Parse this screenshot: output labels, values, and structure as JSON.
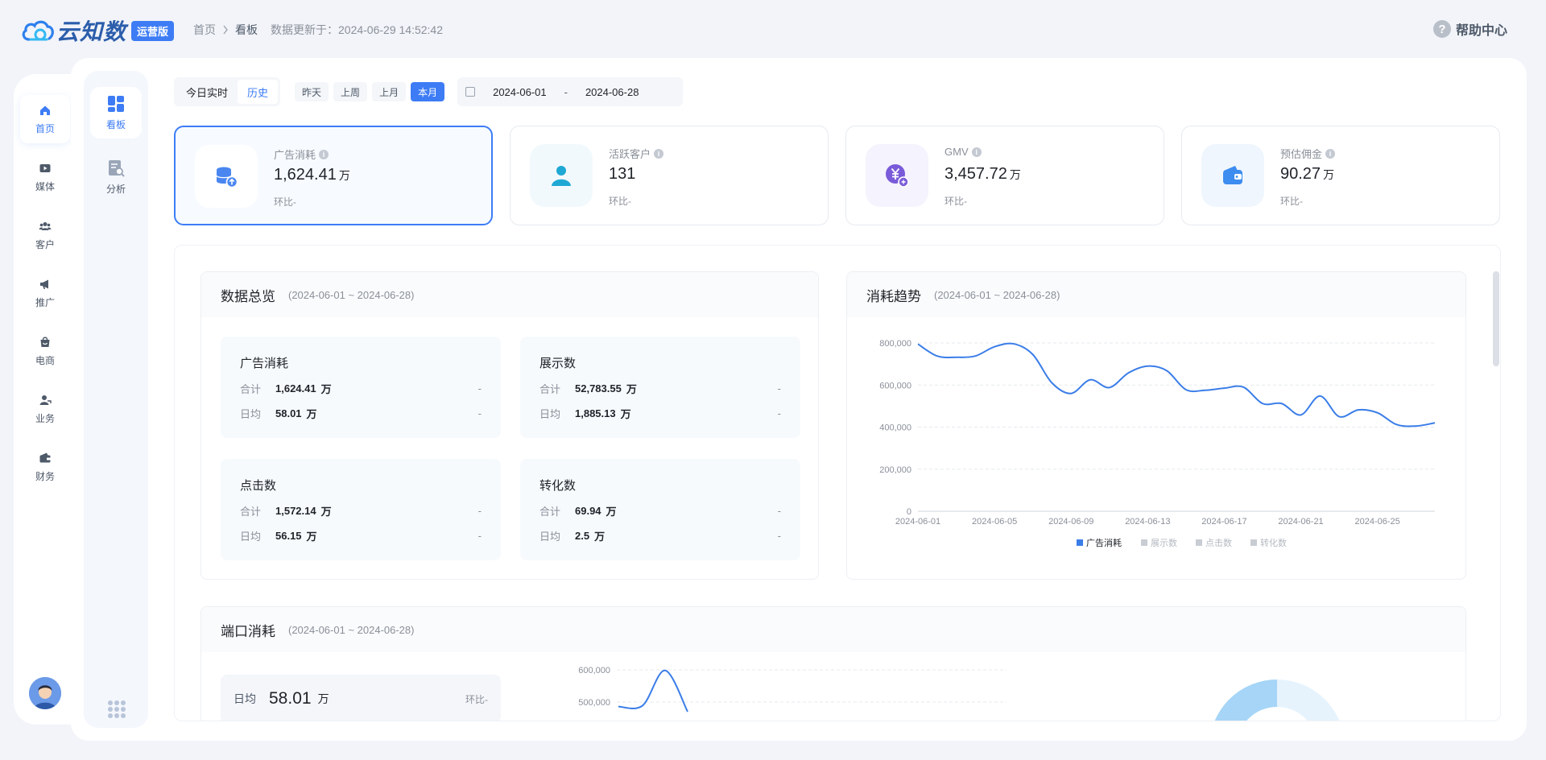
{
  "header": {
    "logo_text": "云知数",
    "logo_badge": "运营版",
    "breadcrumb_home": "首页",
    "breadcrumb_current": "看板",
    "updated_label": "数据更新于：2024-06-29 14:52:42",
    "help_label": "帮助中心"
  },
  "nav": {
    "items": [
      {
        "label": "首页",
        "icon": "home-icon",
        "active": true
      },
      {
        "label": "媒体",
        "icon": "media-icon",
        "active": false
      },
      {
        "label": "客户",
        "icon": "customers-icon",
        "active": false
      },
      {
        "label": "推广",
        "icon": "megaphone-icon",
        "active": false
      },
      {
        "label": "电商",
        "icon": "shop-icon",
        "active": false
      },
      {
        "label": "业务",
        "icon": "user-icon",
        "active": false
      },
      {
        "label": "财务",
        "icon": "wallet-icon",
        "active": false
      }
    ]
  },
  "subnav": {
    "items": [
      {
        "label": "看板",
        "icon": "dashboard-icon",
        "active": true
      },
      {
        "label": "分析",
        "icon": "analysis-icon",
        "active": false
      }
    ]
  },
  "filters": {
    "realtime": "今日实时",
    "history": "历史",
    "yesterday": "昨天",
    "last_week": "上周",
    "last_month": "上月",
    "this_month": "本月",
    "start_date": "2024-06-01",
    "date_sep": "-",
    "end_date": "2024-06-28"
  },
  "kpis": [
    {
      "label": "广告消耗",
      "value": "1,624.41",
      "unit": "万",
      "sub": "环比-",
      "icon": "database-upload-icon",
      "active": true
    },
    {
      "label": "活跃客户",
      "value": "131",
      "unit": "",
      "sub": "环比-",
      "icon": "person-icon",
      "active": false
    },
    {
      "label": "GMV",
      "value": "3,457.72",
      "unit": "万",
      "sub": "环比-",
      "icon": "yuan-coin-icon",
      "active": false
    },
    {
      "label": "预估佣金",
      "value": "90.27",
      "unit": "万",
      "sub": "环比-",
      "icon": "wallet-icon",
      "active": false
    }
  ],
  "overview": {
    "title": "数据总览",
    "range": "(2024-06-01 ~ 2024-06-28)",
    "metrics": [
      {
        "name": "广告消耗",
        "total_label": "合计",
        "total": "1,624.41",
        "avg_label": "日均",
        "avg": "58.01",
        "unit": "万",
        "total_change": "-",
        "avg_change": "-"
      },
      {
        "name": "展示数",
        "total_label": "合计",
        "total": "52,783.55",
        "avg_label": "日均",
        "avg": "1,885.13",
        "unit": "万",
        "total_change": "-",
        "avg_change": "-"
      },
      {
        "name": "点击数",
        "total_label": "合计",
        "total": "1,572.14",
        "avg_label": "日均",
        "avg": "56.15",
        "unit": "万",
        "total_change": "-",
        "avg_change": "-"
      },
      {
        "name": "转化数",
        "total_label": "合计",
        "total": "69.94",
        "avg_label": "日均",
        "avg": "2.5",
        "unit": "万",
        "total_change": "-",
        "avg_change": "-"
      }
    ]
  },
  "trend": {
    "title": "消耗趋势",
    "range": "(2024-06-01 ~ 2024-06-28)"
  },
  "port": {
    "title": "端口消耗",
    "range": "(2024-06-01 ~ 2024-06-28)",
    "daily_label": "日均",
    "daily_value": "58.01",
    "daily_unit": "万",
    "daily_change": "环比-"
  },
  "colors": {
    "accent": "#3d7cf5",
    "line": "#3a7de8",
    "legend_inactive": "#c8ccd3",
    "donut_light": "#e6f3fd",
    "donut_mid": "#a6d5f7"
  },
  "chart_data": [
    {
      "type": "line",
      "title": "消耗趋势",
      "x": [
        "2024-06-01",
        "2024-06-02",
        "2024-06-03",
        "2024-06-04",
        "2024-06-05",
        "2024-06-06",
        "2024-06-07",
        "2024-06-08",
        "2024-06-09",
        "2024-06-10",
        "2024-06-11",
        "2024-06-12",
        "2024-06-13",
        "2024-06-14",
        "2024-06-15",
        "2024-06-16",
        "2024-06-17",
        "2024-06-18",
        "2024-06-19",
        "2024-06-20",
        "2024-06-21",
        "2024-06-22",
        "2024-06-23",
        "2024-06-24",
        "2024-06-25",
        "2024-06-26",
        "2024-06-27",
        "2024-06-28"
      ],
      "x_tick_labels": [
        "2024-06-01",
        "2024-06-05",
        "2024-06-09",
        "2024-06-13",
        "2024-06-17",
        "2024-06-21",
        "2024-06-25"
      ],
      "series": [
        {
          "name": "广告消耗",
          "values": [
            795000,
            738000,
            732000,
            738000,
            782000,
            796000,
            745000,
            610000,
            560000,
            625000,
            588000,
            658000,
            690000,
            668000,
            578000,
            575000,
            585000,
            590000,
            512000,
            512000,
            458000,
            548000,
            450000,
            482000,
            468000,
            412000,
            405000,
            420000
          ]
        },
        {
          "name": "展示数",
          "values": []
        },
        {
          "name": "点击数",
          "values": []
        },
        {
          "name": "转化数",
          "values": []
        }
      ],
      "y_ticks": [
        "800,000",
        "600,000",
        "400,000",
        "200,000",
        "0"
      ],
      "ylim": [
        0,
        800000
      ],
      "legend_position": "bottom",
      "grid": true
    },
    {
      "type": "line",
      "title": "端口消耗",
      "series": [
        {
          "name": "",
          "values": [
            486000,
            489000,
            598000,
            470000
          ]
        }
      ],
      "y_ticks": [
        "600,000",
        "500,000"
      ],
      "grid": true
    }
  ]
}
